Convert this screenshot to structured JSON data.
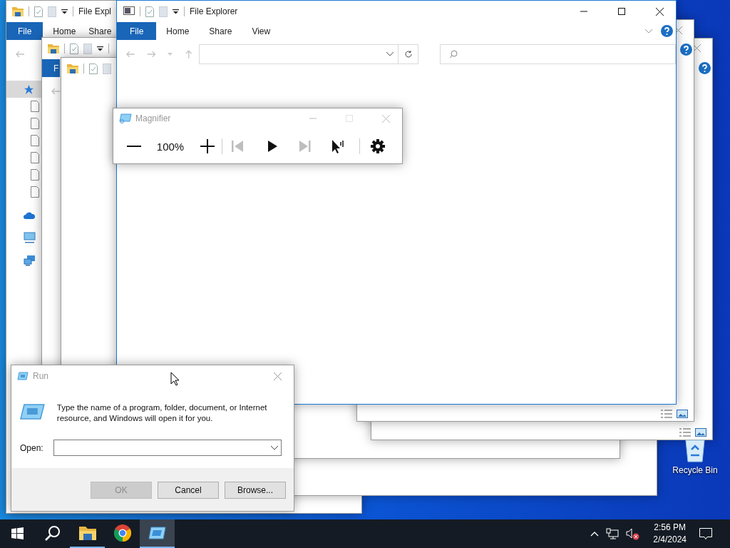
{
  "background_explorer": {
    "title": "File Expl",
    "tabs": [
      {
        "label": "File",
        "kind": "file"
      },
      {
        "label": "Home",
        "kind": "tab"
      },
      {
        "label": "Share",
        "kind": "tab"
      }
    ],
    "nav_items": [
      {
        "kind": "quick-access",
        "selected": true
      },
      {
        "kind": "document",
        "selected": false
      },
      {
        "kind": "document",
        "selected": false
      },
      {
        "kind": "document",
        "selected": false
      },
      {
        "kind": "document",
        "selected": false
      },
      {
        "kind": "document",
        "selected": false
      },
      {
        "kind": "document",
        "selected": false
      },
      {
        "kind": "onedrive",
        "selected": false
      },
      {
        "kind": "pc",
        "selected": false
      },
      {
        "kind": "network",
        "selected": false
      }
    ]
  },
  "middle_explorer": {
    "tabs": [
      {
        "label": "F",
        "kind": "file"
      }
    ]
  },
  "file_explorer": {
    "title": "File Explorer",
    "active": true,
    "tabs": [
      {
        "label": "File",
        "kind": "file"
      },
      {
        "label": "Home",
        "kind": "tab"
      },
      {
        "label": "Share",
        "kind": "tab"
      },
      {
        "label": "View",
        "kind": "tab"
      }
    ]
  },
  "magnifier": {
    "title": "Magnifier",
    "active": false,
    "maximize_disabled": true,
    "controls": [
      {
        "kind": "zoom-out",
        "disabled": false
      },
      {
        "kind": "zoom-level",
        "label": "100%"
      },
      {
        "kind": "zoom-in",
        "disabled": false
      },
      {
        "kind": "separator"
      },
      {
        "kind": "previous",
        "disabled": true
      },
      {
        "kind": "play",
        "disabled": false
      },
      {
        "kind": "next",
        "disabled": true
      },
      {
        "kind": "read-from-pointer",
        "disabled": false
      },
      {
        "kind": "separator"
      },
      {
        "kind": "settings",
        "disabled": false
      }
    ]
  },
  "run_dialog": {
    "title": "Run",
    "active": false,
    "message": "Type the name of a program, folder, document, or Internet resource, and Windows will open it for you.",
    "open_label": "Open:",
    "buttons": [
      {
        "label": "OK",
        "disabled": true
      },
      {
        "label": "Cancel",
        "disabled": false
      },
      {
        "label": "Browse...",
        "disabled": false
      }
    ]
  },
  "desktop_icons": [
    {
      "label": "Recycle Bin"
    }
  ],
  "taskbar": {
    "items": [
      {
        "kind": "start",
        "running": false,
        "active": false
      },
      {
        "kind": "search",
        "running": false,
        "active": false
      },
      {
        "kind": "file-explorer",
        "running": true,
        "active": false
      },
      {
        "kind": "browser",
        "running": false,
        "active": false
      },
      {
        "kind": "magnifier",
        "running": true,
        "active": true
      }
    ],
    "volume_muted": true,
    "time": "2:56 PM",
    "date": "2/4/2024"
  }
}
